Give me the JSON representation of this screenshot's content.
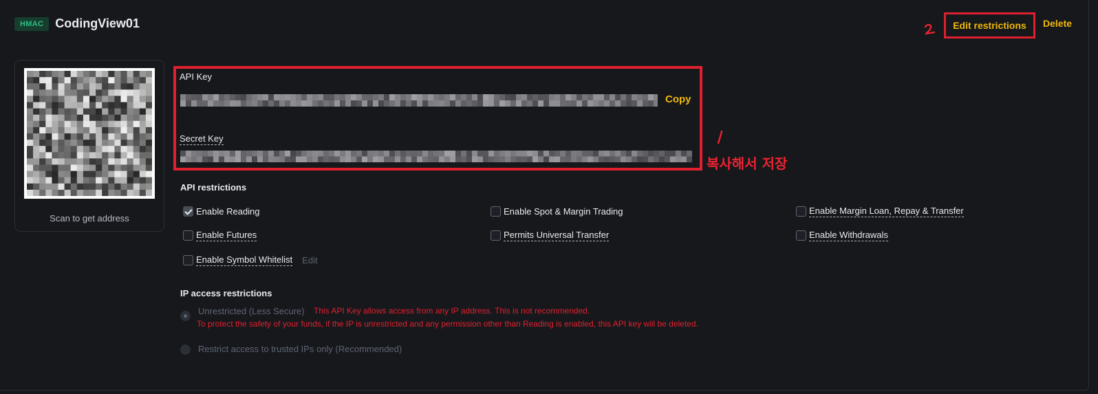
{
  "header": {
    "badge": "HMAC",
    "title": "CodingView01",
    "edit_label": "Edit restrictions",
    "delete_label": "Delete"
  },
  "annotations": {
    "mark_two": "2",
    "mark_one": "1",
    "note": "복사해서 저장",
    "color": "#ee2230"
  },
  "qr": {
    "caption": "Scan to get address"
  },
  "keys": {
    "api_key_label": "API Key",
    "secret_key_label": "Secret Key",
    "copy_label": "Copy"
  },
  "api_restrictions": {
    "title": "API restrictions",
    "permissions": [
      {
        "label": "Enable Reading",
        "checked": true
      },
      {
        "label": "Enable Spot & Margin Trading",
        "checked": false
      },
      {
        "label": "Enable Margin Loan, Repay & Transfer",
        "checked": false
      },
      {
        "label": "Enable Futures",
        "checked": false
      },
      {
        "label": "Permits Universal Transfer",
        "checked": false
      },
      {
        "label": "Enable Withdrawals",
        "checked": false
      },
      {
        "label": "Enable Symbol Whitelist",
        "checked": false
      }
    ],
    "whitelist_edit": "Edit"
  },
  "ip_restrictions": {
    "title": "IP access restrictions",
    "unrestricted_label": "Unrestricted (Less Secure)",
    "warning_line1": "This API Key allows access from any IP address. This is not recommended.",
    "warning_line2": "To protect the safety of your funds, if the IP is unrestricted and any permission other than Reading is enabled, this API key will be deleted.",
    "restricted_label": "Restrict access to trusted IPs only (Recommended)",
    "selected": "unrestricted"
  },
  "colors": {
    "background": "#17181c",
    "accent": "#f0b90b",
    "annotation_red": "#e0202e",
    "badge_green": "#2ebd85"
  }
}
